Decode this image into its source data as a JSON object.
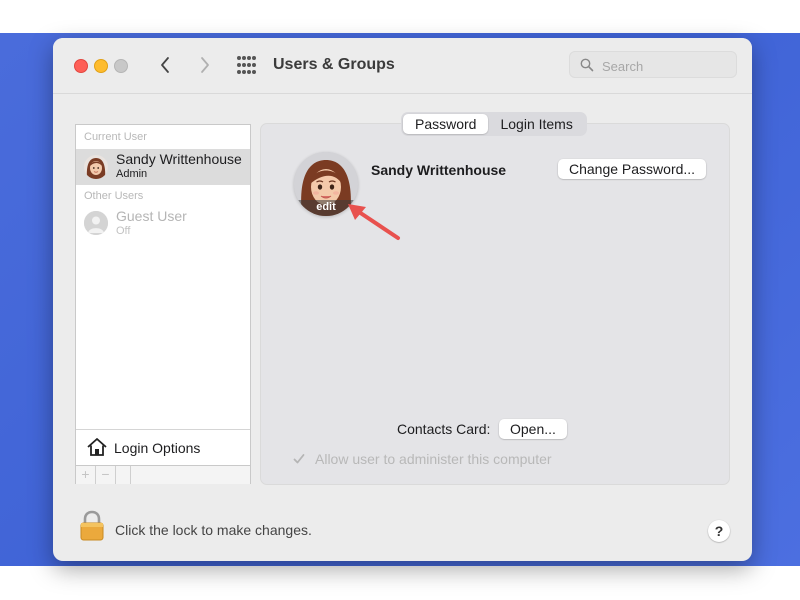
{
  "window": {
    "title": "Users & Groups",
    "search_placeholder": "Search"
  },
  "sidebar": {
    "current_user_header": "Current User",
    "other_users_header": "Other Users",
    "users": [
      {
        "name": "Sandy Writtenhouse",
        "role": "Admin",
        "selected": true
      },
      {
        "name": "Guest User",
        "role": "Off",
        "selected": false
      }
    ],
    "login_options_label": "Login Options",
    "add_label": "+",
    "remove_label": "−"
  },
  "tabs": [
    {
      "label": "Password",
      "active": true
    },
    {
      "label": "Login Items",
      "active": false
    }
  ],
  "profile": {
    "name": "Sandy Writtenhouse",
    "edit_label": "edit",
    "change_password_label": "Change Password..."
  },
  "contacts": {
    "label": "Contacts Card:",
    "open_label": "Open..."
  },
  "admin_checkbox": {
    "label": "Allow user to administer this computer",
    "checked": true,
    "enabled": false
  },
  "footer": {
    "lock_text": "Click the lock to make changes.",
    "help_label": "?"
  },
  "colors": {
    "desktop": "#4a6cdb",
    "close": "#fe5f57",
    "minimize": "#febc2e",
    "annotation_arrow": "#e8514e"
  }
}
